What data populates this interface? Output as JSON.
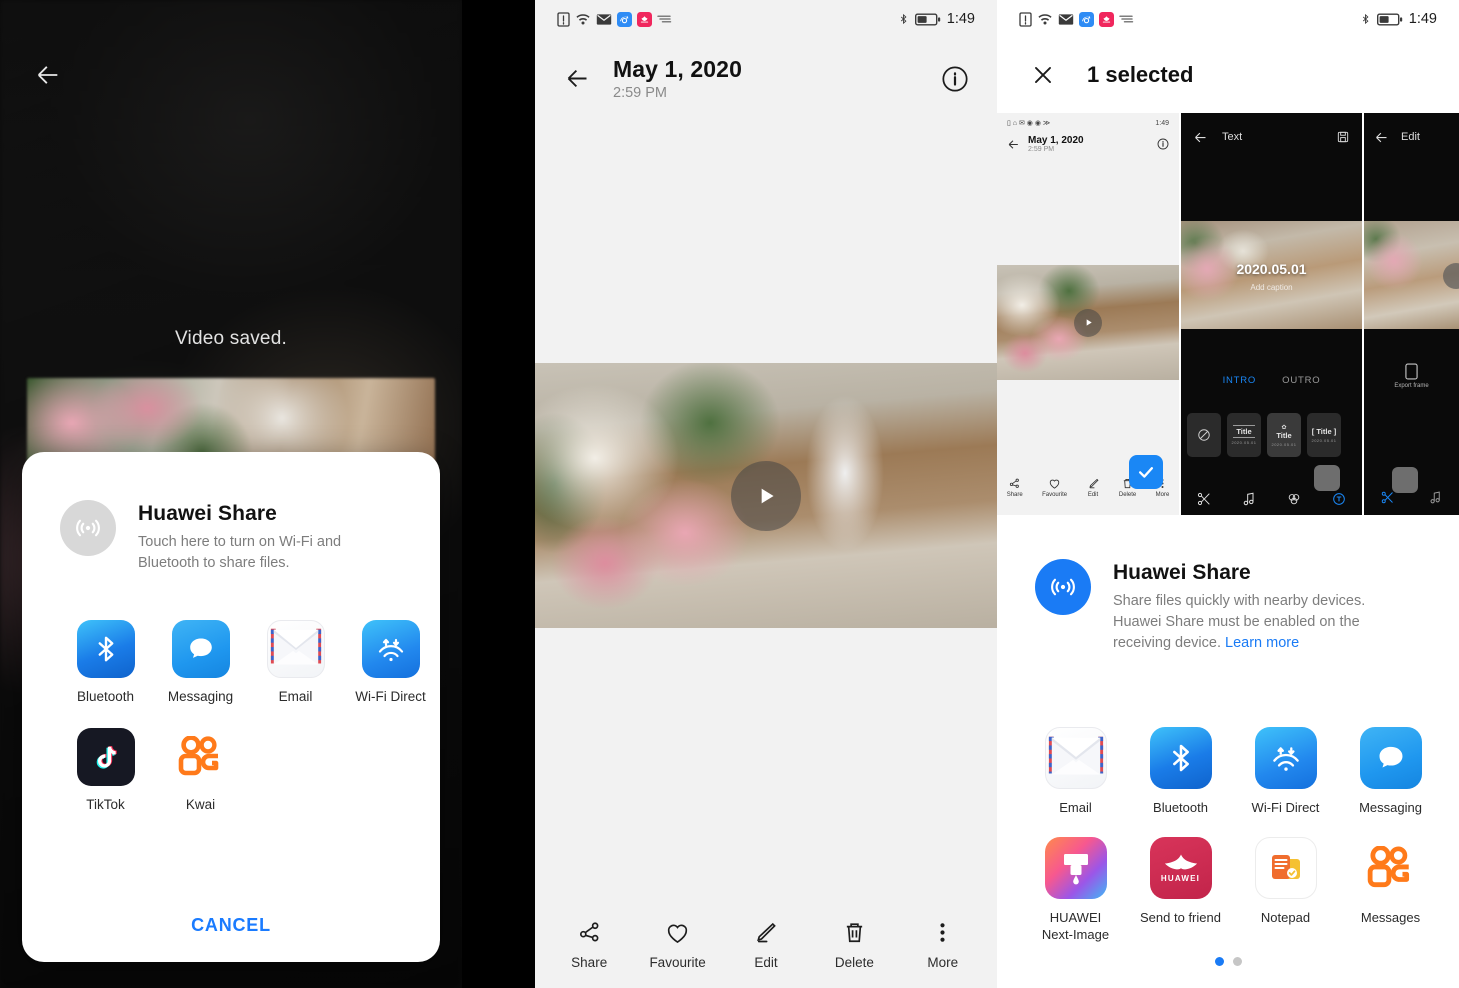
{
  "panel1": {
    "back_icon": "arrow-left-icon",
    "saved_text": "Video saved.",
    "share_sheet": {
      "icon": "huawei-share-icon",
      "title": "Huawei Share",
      "subtitle": "Touch here to turn on Wi-Fi and Bluetooth to share files.",
      "apps": [
        {
          "label": "Bluetooth",
          "icon": "bluetooth-icon"
        },
        {
          "label": "Messaging",
          "icon": "messaging-icon"
        },
        {
          "label": "Email",
          "icon": "email-icon"
        },
        {
          "label": "Wi-Fi Direct",
          "icon": "wifi-direct-icon"
        },
        {
          "label": "TikTok",
          "icon": "tiktok-icon"
        },
        {
          "label": "Kwai",
          "icon": "kwai-icon"
        }
      ],
      "cancel_label": "CANCEL"
    }
  },
  "panel2": {
    "statusbar": {
      "icons": [
        "sim-alert-icon",
        "wifi-icon",
        "mail-icon",
        "browser-icon",
        "huawei-app-icon",
        "data-flow-icon"
      ],
      "right_icons": [
        "bluetooth-icon",
        "battery-icon"
      ],
      "time": "1:49"
    },
    "header": {
      "back_icon": "arrow-left-icon",
      "date": "May 1, 2020",
      "time": "2:59 PM",
      "info_icon": "info-circle-icon"
    },
    "media": {
      "play_icon": "play-icon"
    },
    "toolbar": [
      {
        "label": "Share",
        "icon": "share-icon"
      },
      {
        "label": "Favourite",
        "icon": "heart-icon"
      },
      {
        "label": "Edit",
        "icon": "pencil-icon"
      },
      {
        "label": "Delete",
        "icon": "trash-icon"
      },
      {
        "label": "More",
        "icon": "more-vertical-icon"
      }
    ]
  },
  "panel3": {
    "statusbar": {
      "icons": [
        "sim-alert-icon",
        "wifi-icon",
        "mail-icon",
        "browser-icon",
        "huawei-app-icon",
        "data-flow-icon"
      ],
      "right_icons": [
        "bluetooth-icon",
        "battery-icon"
      ],
      "time": "1:49"
    },
    "selection": {
      "close_icon": "close-icon",
      "label": "1 selected"
    },
    "thumbnails": {
      "gallery": {
        "status_time": "1:49",
        "date": "May 1, 2020",
        "time": "2:59 PM",
        "info_icon": "info-circle-icon",
        "back_icon": "arrow-left-icon",
        "play_icon": "play-icon",
        "checked_icon": "check-icon",
        "toolbar": [
          {
            "label": "Share",
            "icon": "share-icon"
          },
          {
            "label": "Favourite",
            "icon": "heart-icon"
          },
          {
            "label": "Edit",
            "icon": "pencil-icon"
          },
          {
            "label": "Delete",
            "icon": "trash-icon"
          },
          {
            "label": "More",
            "icon": "more-vertical-icon"
          }
        ]
      },
      "text_editor": {
        "back_icon": "arrow-left-icon",
        "title": "Text",
        "save_icon": "save-icon",
        "overlay_date": "2020.05.01",
        "overlay_caption": "Add caption",
        "tabs": [
          {
            "label": "INTRO",
            "active": true
          },
          {
            "label": "OUTRO",
            "active": false
          }
        ],
        "presets": [
          {
            "label": "",
            "sub": "",
            "icon": "no-style-icon"
          },
          {
            "label": "Title",
            "sub": "2020.05.01"
          },
          {
            "label": "Title",
            "sub": "2020.05.01"
          },
          {
            "label": "[ Title ]",
            "sub": "2020.05.01"
          }
        ],
        "bottom_icons": [
          "scissors-icon",
          "music-icon",
          "filters-icon",
          "text-tool-icon"
        ]
      },
      "edit_editor": {
        "back_icon": "arrow-left-icon",
        "title": "Edit",
        "export_label": "Export frame",
        "export_icon": "phone-frame-icon",
        "bottom_icons": [
          "scissors-icon",
          "music-icon"
        ]
      }
    },
    "share_sheet": {
      "icon": "huawei-share-icon",
      "title": "Huawei Share",
      "subtitle": "Share files quickly with nearby devices. Huawei Share must be enabled on the receiving device. ",
      "learn_more": "Learn more",
      "apps": [
        {
          "label": "Email",
          "icon": "email-icon"
        },
        {
          "label": "Bluetooth",
          "icon": "bluetooth-icon"
        },
        {
          "label": "Wi-Fi Direct",
          "icon": "wifi-direct-icon"
        },
        {
          "label": "Messaging",
          "icon": "messaging-icon"
        },
        {
          "label": "HUAWEI\nNext-Image",
          "icon": "huawei-next-image-icon"
        },
        {
          "label": "Send to friend",
          "icon": "huawei-icon"
        },
        {
          "label": "Notepad",
          "icon": "notepad-icon"
        },
        {
          "label": "Messages",
          "icon": "kwai-messages-icon"
        }
      ],
      "page_dots": {
        "total": 2,
        "active": 0
      }
    }
  },
  "colors": {
    "accent_blue": "#1a7bf5",
    "cancel_blue": "#1a7bff",
    "huawei_red": "#c2244a",
    "panel_bg": "#f2f2f2"
  }
}
